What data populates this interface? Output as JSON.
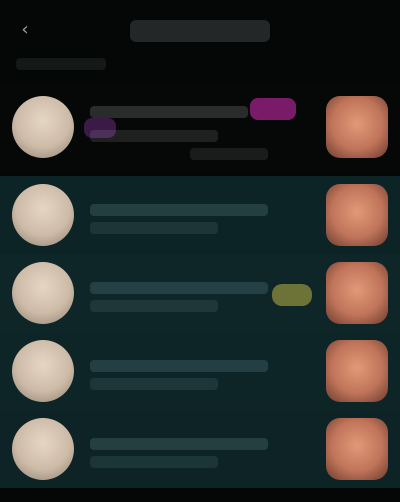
{
  "header": {
    "back_icon": "chevron-left-icon",
    "title": "",
    "section_label": ""
  },
  "featured": {
    "name": "",
    "subtitle": "",
    "meta": "",
    "badge_colors": {
      "pink": "#7a1b6a",
      "purple": "#3b1a47"
    }
  },
  "rows": [
    {
      "name": "",
      "subtitle": "",
      "background": "#0d2427"
    },
    {
      "name": "",
      "subtitle": "",
      "background": "#0f2629",
      "badge_color": "#6d7236"
    },
    {
      "name": "",
      "subtitle": "",
      "background": "#0e2528"
    },
    {
      "name": "",
      "subtitle": "",
      "background": "#0d2326"
    }
  ],
  "colors": {
    "page_background": "#050606",
    "row_teal": "#0d2427"
  }
}
